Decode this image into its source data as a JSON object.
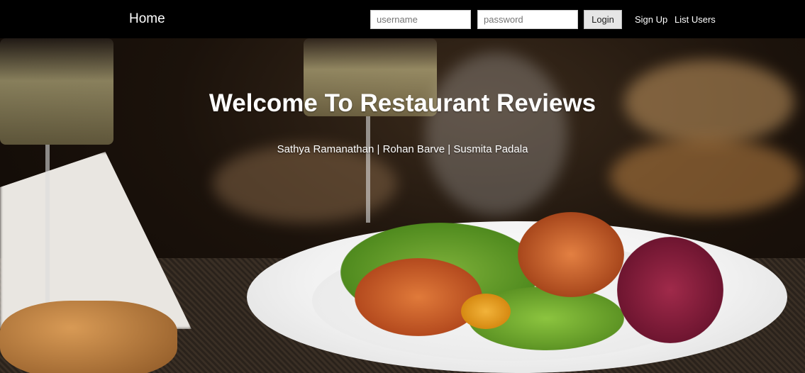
{
  "navbar": {
    "brand": "Home",
    "username_placeholder": "username",
    "password_placeholder": "password",
    "login_label": "Login",
    "signup_label": "Sign Up",
    "list_users_label": "List Users"
  },
  "hero": {
    "title": "Welcome To Restaurant Reviews",
    "subtitle": "Sathya Ramanathan | Rohan Barve | Susmita Padala"
  },
  "colors": {
    "navbar_bg": "#000000",
    "text": "#ffffff"
  }
}
